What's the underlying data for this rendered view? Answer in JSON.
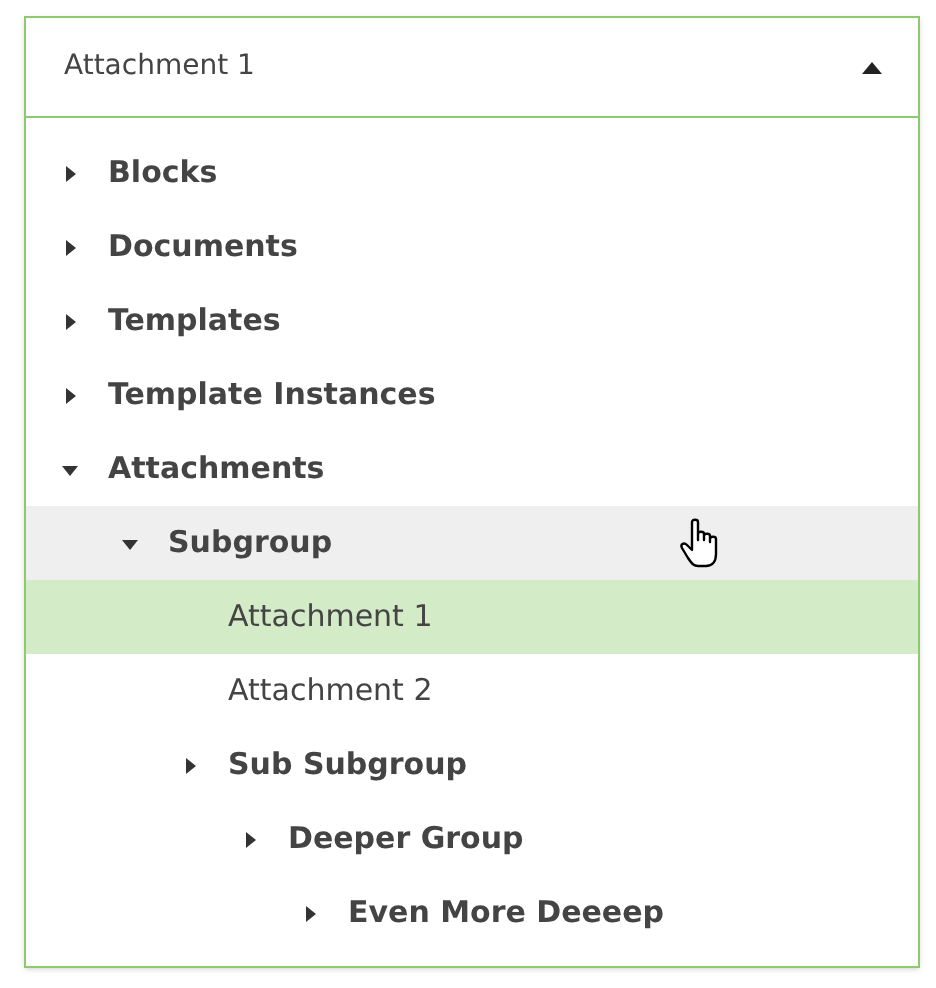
{
  "select": {
    "value": "Attachment 1",
    "expanded": true
  },
  "tree": [
    {
      "label": "Blocks",
      "kind": "group",
      "expanded": false,
      "selected": false,
      "hovered": false
    },
    {
      "label": "Documents",
      "kind": "group",
      "expanded": false,
      "selected": false,
      "hovered": false
    },
    {
      "label": "Templates",
      "kind": "group",
      "expanded": false,
      "selected": false,
      "hovered": false
    },
    {
      "label": "Template Instances",
      "kind": "group",
      "expanded": false,
      "selected": false,
      "hovered": false
    },
    {
      "label": "Attachments",
      "kind": "group",
      "expanded": true,
      "selected": false,
      "hovered": false,
      "children": [
        {
          "label": "Subgroup",
          "kind": "group",
          "expanded": true,
          "selected": false,
          "hovered": true,
          "children": [
            {
              "label": "Attachment 1",
              "kind": "leaf",
              "selected": true,
              "hovered": false
            },
            {
              "label": "Attachment 2",
              "kind": "leaf",
              "selected": false,
              "hovered": false
            },
            {
              "label": "Sub Subgroup",
              "kind": "group",
              "expanded": false,
              "selected": false,
              "hovered": false,
              "children": [
                {
                  "label": "Deeper Group",
                  "kind": "group",
                  "expanded": false,
                  "selected": false,
                  "hovered": false,
                  "children": [
                    {
                      "label": "Even More Deeeep",
                      "kind": "group",
                      "expanded": false,
                      "selected": false,
                      "hovered": false
                    }
                  ]
                }
              ]
            }
          ]
        }
      ]
    }
  ]
}
